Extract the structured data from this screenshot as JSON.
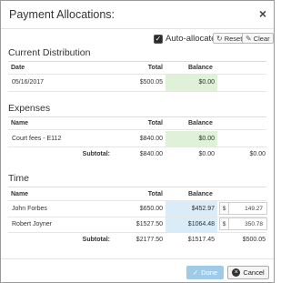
{
  "dialog": {
    "title": "Payment Allocations:",
    "close_glyph": "×"
  },
  "toolbar": {
    "auto_allocate_label": "Auto-allocate",
    "auto_allocate_checked": true,
    "reset_label": "Reset",
    "clear_label": "Clear"
  },
  "current_distribution": {
    "heading": "Current Distribution",
    "columns": [
      "Date",
      "Total",
      "Balance"
    ],
    "rows": [
      {
        "date": "05/16/2017",
        "total": "$500.05",
        "balance": "$0.00"
      }
    ]
  },
  "expenses": {
    "heading": "Expenses",
    "columns": [
      "Name",
      "Total",
      "Balance"
    ],
    "rows": [
      {
        "name": "Court fees - E112",
        "total": "$840.00",
        "balance": "$0.00"
      }
    ],
    "subtotal": {
      "label": "Subtotal:",
      "total": "$840.00",
      "balance": "$0.00",
      "allocated": "$0.00"
    }
  },
  "time": {
    "heading": "Time",
    "columns": [
      "Name",
      "Total",
      "Balance"
    ],
    "rows": [
      {
        "name": "John Forbes",
        "total": "$650.00",
        "balance": "$452.97",
        "currency": "$",
        "allocation": "149.27"
      },
      {
        "name": "Robert Joyner",
        "total": "$1527.50",
        "balance": "$1064.48",
        "currency": "$",
        "allocation": "350.78"
      }
    ],
    "subtotal": {
      "label": "Subtotal:",
      "total": "$2177.50",
      "balance": "$1517.45",
      "allocated": "$500.05"
    }
  },
  "footer": {
    "done_label": "Done",
    "cancel_label": "Cancel"
  },
  "colors": {
    "paid_balance_bg": "#dff1d8",
    "open_balance_bg": "#d9ecf7",
    "done_button_bg": "#9fcbe8"
  }
}
